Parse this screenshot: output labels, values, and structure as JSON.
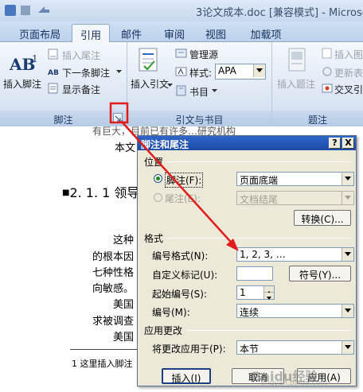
{
  "window": {
    "title": "3论文成本.doc [兼容模式] - Microsoft"
  },
  "tabs": [
    {
      "label": "页面布局",
      "active": false
    },
    {
      "label": "引用",
      "active": true
    },
    {
      "label": "邮件",
      "active": false
    },
    {
      "label": "审阅",
      "active": false
    },
    {
      "label": "视图",
      "active": false
    },
    {
      "label": "加载项",
      "active": false
    }
  ],
  "ribbon": {
    "footnotes": {
      "group_label": "脚注",
      "insert_footnote": "插入脚注",
      "insert_endnote": "插入尾注",
      "next_footnote": "下一条脚注",
      "show_notes": "显示备注",
      "big_icon_text": "AB",
      "big_icon_sup": "1"
    },
    "citations": {
      "group_label": "引文与书目",
      "insert_citation": "插入引文",
      "manage_sources": "管理源",
      "style_label": "样式:",
      "style_value": "APA",
      "bibliography": "书目"
    },
    "captions": {
      "group_label": "题注",
      "insert_caption": "插入题注",
      "insert_table_figures": "插入图",
      "update_table": "更新表",
      "cross_reference": "交叉引"
    }
  },
  "document": {
    "line_top": "有巨大，目前已有许多…研究机构",
    "line_body": "本文",
    "heading": "2. 1. 1 领导",
    "p1": "这种",
    "p2": "的根本因",
    "p3": "七种性格",
    "p4": "向敏感。",
    "p5": "美国",
    "p6": "求被调查",
    "p7": "美国",
    "footnote": "1 这里插入脚注"
  },
  "dialog": {
    "title": "脚注和尾注",
    "help_button": "?",
    "close_button": "X",
    "location": {
      "section": "位置",
      "footnote_option": "脚注(F):",
      "footnote_value": "页面底端",
      "endnote_option": "尾注(E):",
      "endnote_value": "文档结尾",
      "convert_button": "转换(C)..."
    },
    "format": {
      "section": "格式",
      "number_format_label": "编号格式(N):",
      "number_format_value": "1, 2, 3, …",
      "custom_mark_label": "自定义标记(U):",
      "symbol_button": "符号(Y)...",
      "start_at_label": "起始编号(S):",
      "start_at_value": "1",
      "numbering_label": "编号(M):",
      "numbering_value": "连续"
    },
    "apply": {
      "section": "应用更改",
      "apply_to_label": "将更改应用于(P):",
      "apply_to_value": "本节"
    },
    "insert_button": "插入(I)",
    "cancel_button": "取消",
    "apply_button": "应用(A)"
  },
  "watermark": {
    "text": "Baidu经验",
    "subtext": "jingyan.baidu.com"
  },
  "colors": {
    "accent": "#1c4aa6",
    "annotation": "#e21b1b",
    "tab_text": "#15325e"
  }
}
